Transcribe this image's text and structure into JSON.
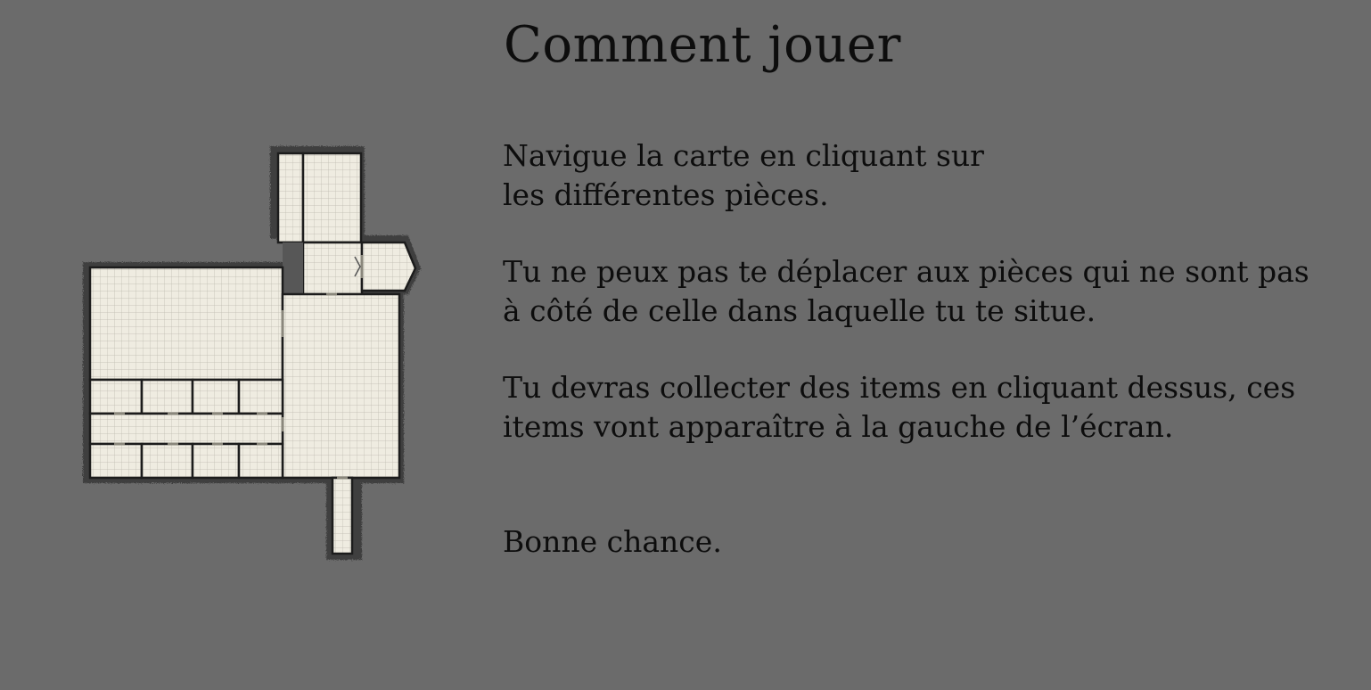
{
  "title": "Comment jouer",
  "instructions": {
    "navigate": [
      "Navigue la carte en cliquant sur",
      "les différentes pièces."
    ],
    "adjacency": [
      "Tu ne peux pas te déplacer aux pièces qui ne sont pas",
      "à côté de celle dans laquelle tu te situe."
    ],
    "collect": [
      "Tu devras collecter des items en cliquant dessus, ces",
      "items vont apparaître à la gauche de l’écran."
    ],
    "farewell": "Bonne chance."
  },
  "colors": {
    "background": "#6b6b6b",
    "text": "#0d0d0d",
    "map_floor": "#efece1",
    "map_grid": "#b9b6ab",
    "map_wall": "#1c1c1c",
    "map_rock": "#3a3a3a"
  },
  "map": {
    "icon": "dungeon-floorplan-icon",
    "rooms": [
      "north-tower-left",
      "north-tower-right",
      "tower-base",
      "east-entrance",
      "great-hall",
      "central-hall",
      "cell-1",
      "cell-2",
      "cell-3",
      "cell-4",
      "long-corridor",
      "cell-5",
      "cell-6",
      "cell-7",
      "cell-8",
      "south-corridor"
    ]
  }
}
